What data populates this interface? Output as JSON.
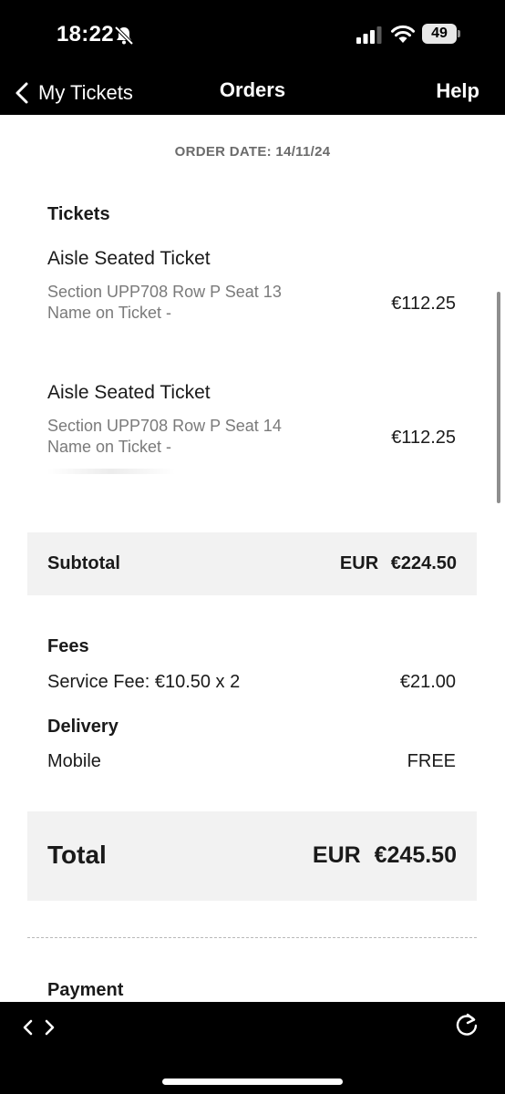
{
  "status_bar": {
    "time": "18:22",
    "battery_level": "49",
    "icons": [
      "bell-slash-icon",
      "signal-icon",
      "wifi-icon",
      "battery-icon"
    ]
  },
  "nav": {
    "back_label": "My Tickets",
    "title": "Orders",
    "help_label": "Help"
  },
  "order": {
    "date_label": "ORDER DATE: 14/11/24",
    "tickets_heading": "Tickets",
    "tickets": [
      {
        "name": "Aisle Seated Ticket",
        "detail": "Section UPP708  Row P  Seat 13",
        "name_on_ticket": "Name on Ticket -",
        "price": "€112.25"
      },
      {
        "name": "Aisle Seated Ticket",
        "detail": "Section UPP708  Row P  Seat 14",
        "name_on_ticket": "Name on Ticket -",
        "price": "€112.25"
      }
    ],
    "subtotal": {
      "label": "Subtotal",
      "value": "EUR €224.50"
    },
    "fees": {
      "heading": "Fees",
      "service_fee_label": "Service Fee: €10.50 x 2",
      "service_fee_value": "€21.00"
    },
    "delivery": {
      "heading": "Delivery",
      "method": "Mobile",
      "value": "FREE"
    },
    "total": {
      "label": "Total",
      "value": "EUR €245.50"
    },
    "payment_heading": "Payment"
  },
  "browser_bar": {
    "icons": [
      "back-forward-arrows-icon",
      "reload-icon"
    ]
  },
  "colors": {
    "bar_background": "#000000",
    "content_background": "#ffffff",
    "summary_box": "#f2f2f2",
    "secondary_text": "#7a7a7a"
  }
}
